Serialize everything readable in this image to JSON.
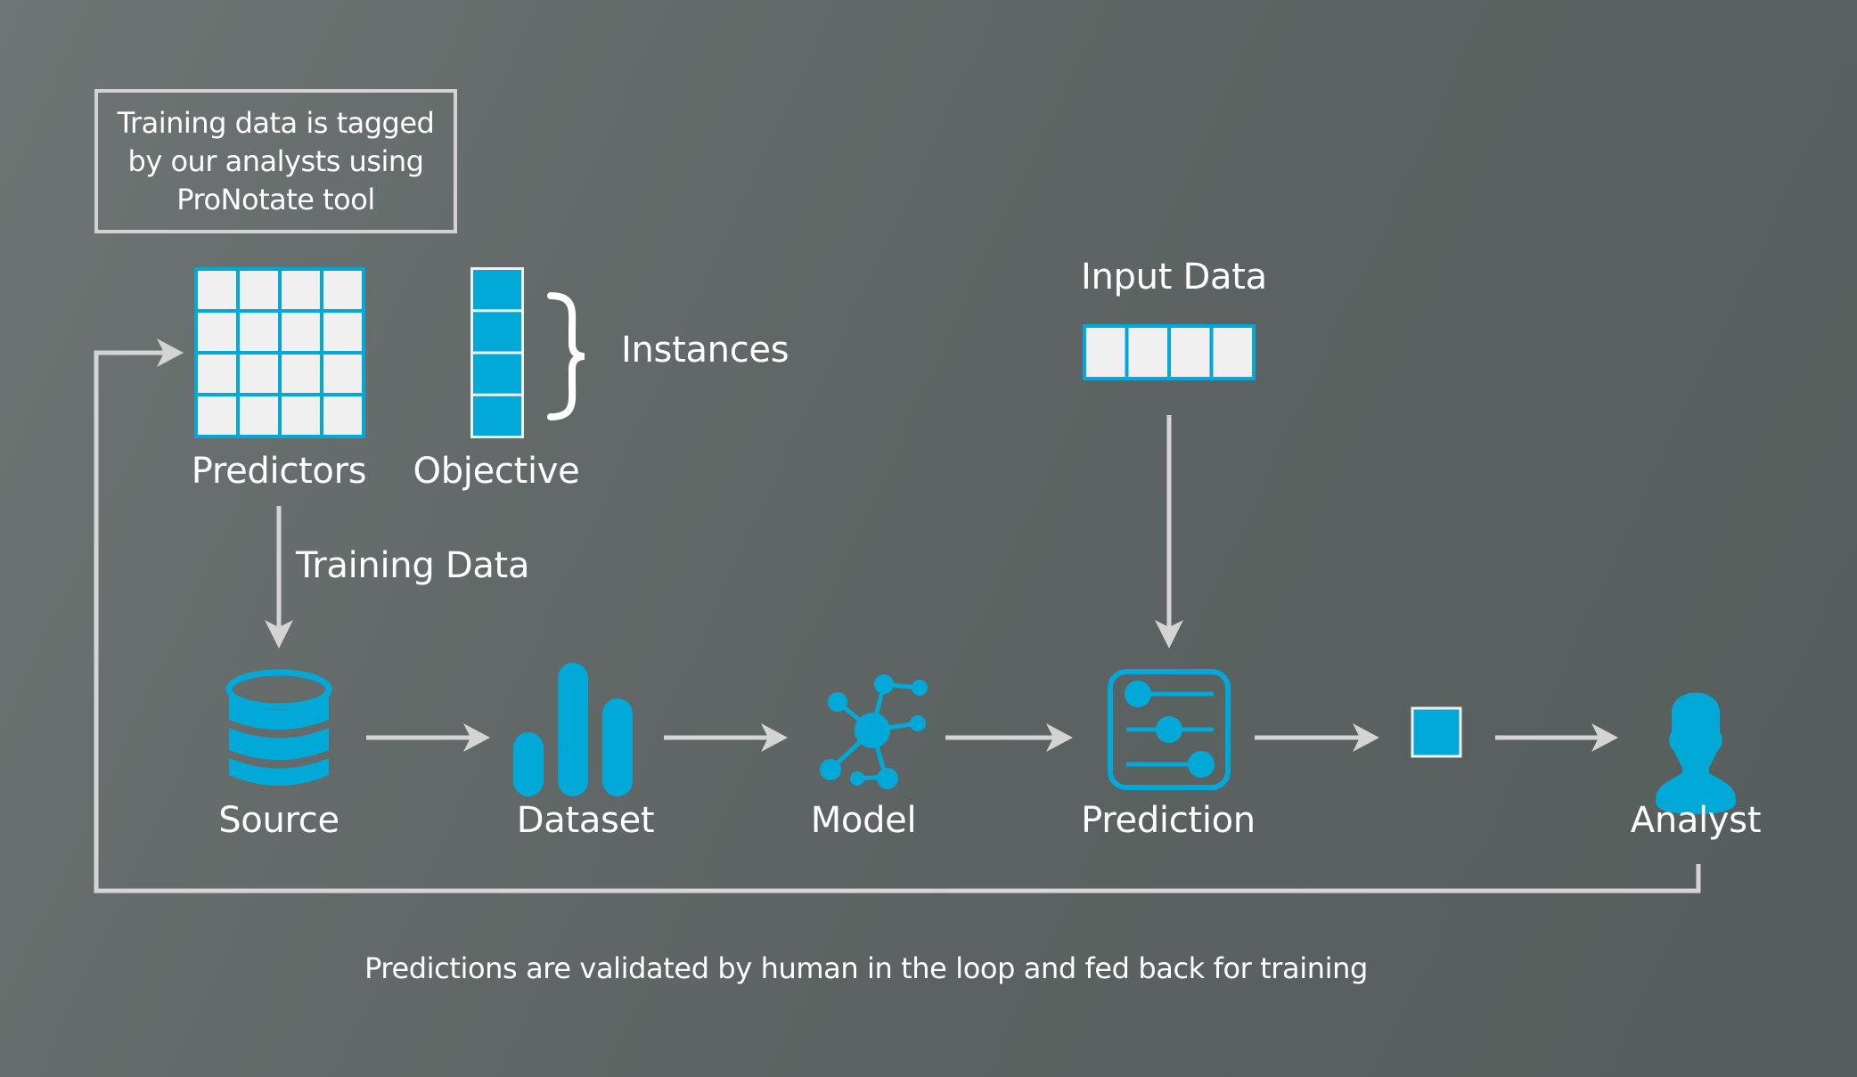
{
  "colors": {
    "accent": "#00a9d8",
    "cell_fill": "#f0f0f0",
    "line": "#d4d4d4",
    "text": "#ffffff",
    "background_start": "#6e7574",
    "background_end": "#565e5d"
  },
  "note": {
    "lines": [
      "Training data is tagged",
      "by our analysts using",
      "ProNotate tool"
    ]
  },
  "training_set": {
    "predictors_label": "Predictors",
    "objective_label": "Objective",
    "instances_label": "Instances",
    "predictor_grid": {
      "rows": 4,
      "columns": 4
    },
    "objective_cells": 4
  },
  "input": {
    "label": "Input Data",
    "cells": 4
  },
  "flow_labels": {
    "training_data": "Training Data"
  },
  "pipeline": [
    {
      "id": "source",
      "label": "Source",
      "icon": "database-icon"
    },
    {
      "id": "dataset",
      "label": "Dataset",
      "icon": "bar-chart-icon"
    },
    {
      "id": "model",
      "label": "Model",
      "icon": "network-icon"
    },
    {
      "id": "prediction",
      "label": "Prediction",
      "icon": "sliders-icon"
    },
    {
      "id": "output",
      "label": "",
      "icon": "output-square-icon"
    },
    {
      "id": "analyst",
      "label": "Analyst",
      "icon": "user-icon"
    }
  ],
  "caption": "Predictions are validated by human in the loop and fed back for training"
}
